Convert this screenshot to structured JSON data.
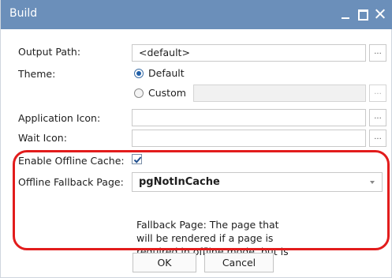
{
  "window": {
    "title": "Build",
    "controls": {
      "minimize": "minimize-icon",
      "maximize": "maximize-icon",
      "close": "close-icon"
    },
    "title_bar_color": "#6b8fba"
  },
  "form": {
    "output_path": {
      "label": "Output Path:",
      "value": "<default>",
      "browse_label": "..."
    },
    "theme": {
      "label": "Theme:",
      "option_default": "Default",
      "option_custom": "Custom",
      "selected": "Default",
      "custom_value": "",
      "browse_label": "..."
    },
    "application_icon": {
      "label": "Application Icon:",
      "value": "",
      "browse_label": "..."
    },
    "wait_icon": {
      "label": "Wait Icon:",
      "value": "",
      "browse_label": "..."
    },
    "enable_offline_cache": {
      "label": "Enable Offline Cache:",
      "checked": true
    },
    "offline_fallback_page": {
      "label": "Offline Fallback Page:",
      "value": "pgNotInCache",
      "help": "Fallback Page: The page that will be rendered if a page is required in offline mode, but is not cached."
    }
  },
  "buttons": {
    "ok": "OK",
    "cancel": "Cancel"
  },
  "highlight_color": "#e21c1c"
}
